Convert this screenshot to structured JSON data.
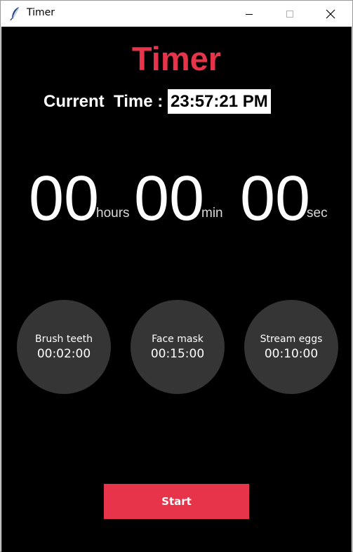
{
  "window": {
    "title": "Timer",
    "app_icon": "feather-icon",
    "controls": {
      "minimize_icon": "minimize-icon",
      "maximize_icon": "maximize-icon",
      "close_icon": "close-icon"
    }
  },
  "header": {
    "title": "Timer"
  },
  "clock": {
    "label": "Current  Time :",
    "value": "23:57:21 PM"
  },
  "countdown": {
    "hours": "00",
    "hours_unit": "hours",
    "minutes": "00",
    "minutes_unit": "min",
    "seconds": "00",
    "seconds_unit": "sec"
  },
  "presets": [
    {
      "name": "Brush teeth",
      "time": "00:02:00"
    },
    {
      "name": "Face mask",
      "time": "00:15:00"
    },
    {
      "name": "Stream eggs",
      "time": "00:10:00"
    }
  ],
  "actions": {
    "start_label": "Start"
  },
  "colors": {
    "accent": "#e8344a",
    "background": "#000000",
    "preset_circle": "#353535",
    "text": "#ffffff"
  }
}
